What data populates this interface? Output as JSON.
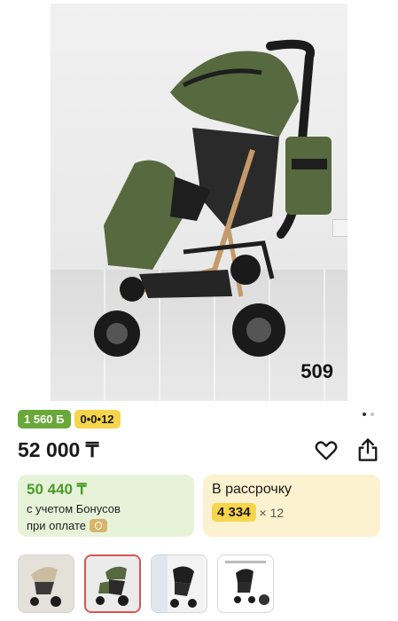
{
  "product": {
    "photo_label": "509",
    "price": "52 000 ₸"
  },
  "badges": {
    "bonus": "1 560 Б",
    "installment": "0•0•12"
  },
  "gallery_dots": {
    "count": 2,
    "active": 1
  },
  "bonus_card": {
    "value": "50 440 ₸",
    "line1": "с учетом Бонусов",
    "line2": "при оплате"
  },
  "installment_card": {
    "title": "В рассрочку",
    "amount": "4 334",
    "multiplier": "× 12"
  },
  "thumbnails": [
    {
      "name": "thumb-beige-stroller",
      "selected": false
    },
    {
      "name": "thumb-green-stroller",
      "selected": true
    },
    {
      "name": "thumb-black-stroller-room",
      "selected": false
    },
    {
      "name": "thumb-stroller-infographic",
      "selected": false
    }
  ],
  "colors": {
    "bonus_green": "#6aa83a",
    "installment_yellow": "#f6d54a",
    "stroller_green": "#56693f"
  },
  "icons": {
    "favorite": "heart-icon",
    "share": "share-icon"
  }
}
